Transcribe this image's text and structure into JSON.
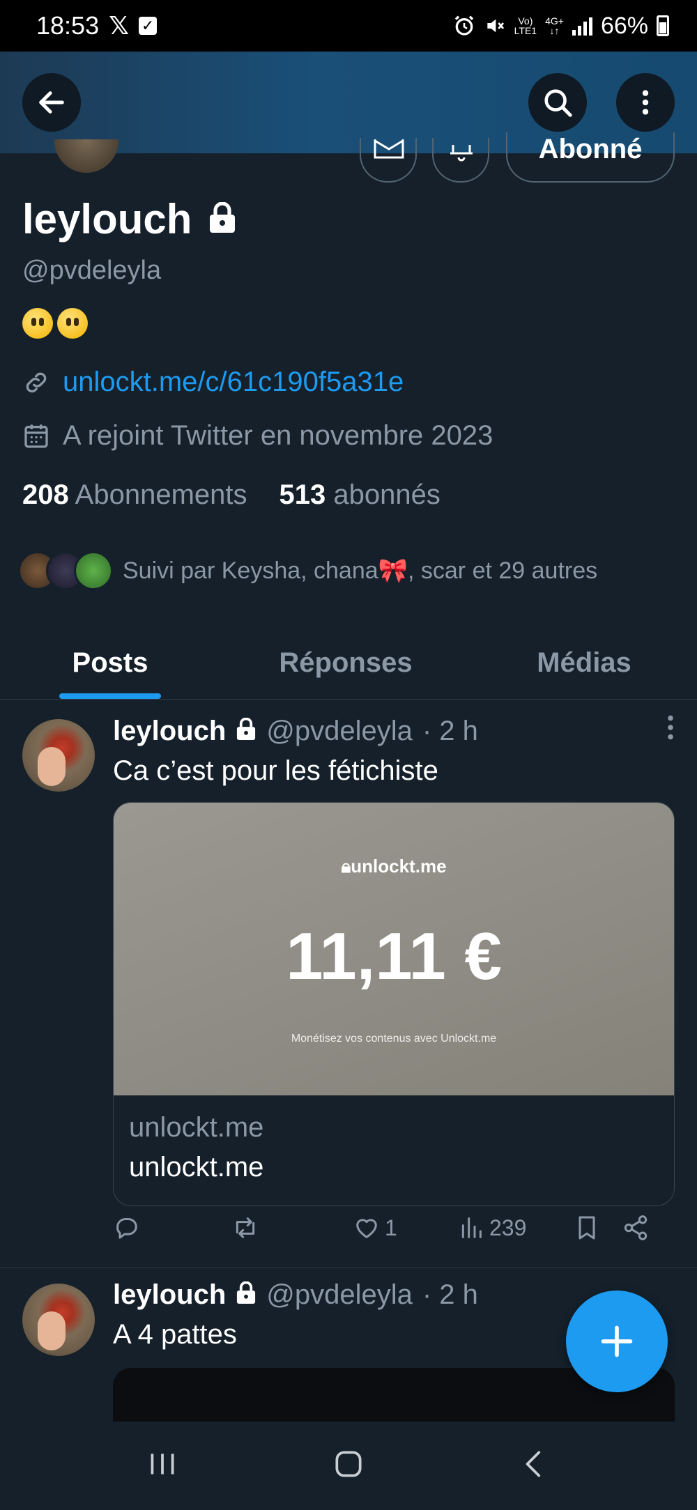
{
  "status_bar": {
    "time": "18:53",
    "network_top": "Vo)",
    "network_bottom": "LTE1",
    "data_top": "4G+",
    "battery": "66%"
  },
  "profile": {
    "name": "leylouch",
    "handle": "@pvdeleyla",
    "follow_button": "Abonné",
    "link": "unlockt.me/c/61c190f5a31e",
    "joined": "A rejoint Twitter en novembre 2023",
    "following_count": "208",
    "following_label": "Abonnements",
    "followers_count": "513",
    "followers_label": "abonnés",
    "followed_by": "Suivi par Keysha, chana🎀, scar et 29 autres"
  },
  "tabs": [
    {
      "label": "Posts",
      "active": true
    },
    {
      "label": "Réponses",
      "active": false
    },
    {
      "label": "Médias",
      "active": false
    }
  ],
  "posts": [
    {
      "name": "leylouch",
      "handle": "@pvdeleyla",
      "time": "· 2 h",
      "text": "Ca c’est pour les fétichiste",
      "card": {
        "brand": "unlockt.me",
        "price": "11,11 €",
        "subtitle": "Monétisez vos contenus avec Unlockt.me",
        "domain": "unlockt.me",
        "title": "unlockt.me"
      },
      "likes": "1",
      "views": "239"
    },
    {
      "name": "leylouch",
      "handle": "@pvdeleyla",
      "time": "· 2 h",
      "text": "A 4 pattes"
    }
  ],
  "colors": {
    "background": "#15202b",
    "accent": "#1d9bf0",
    "muted": "#8b98a5"
  }
}
